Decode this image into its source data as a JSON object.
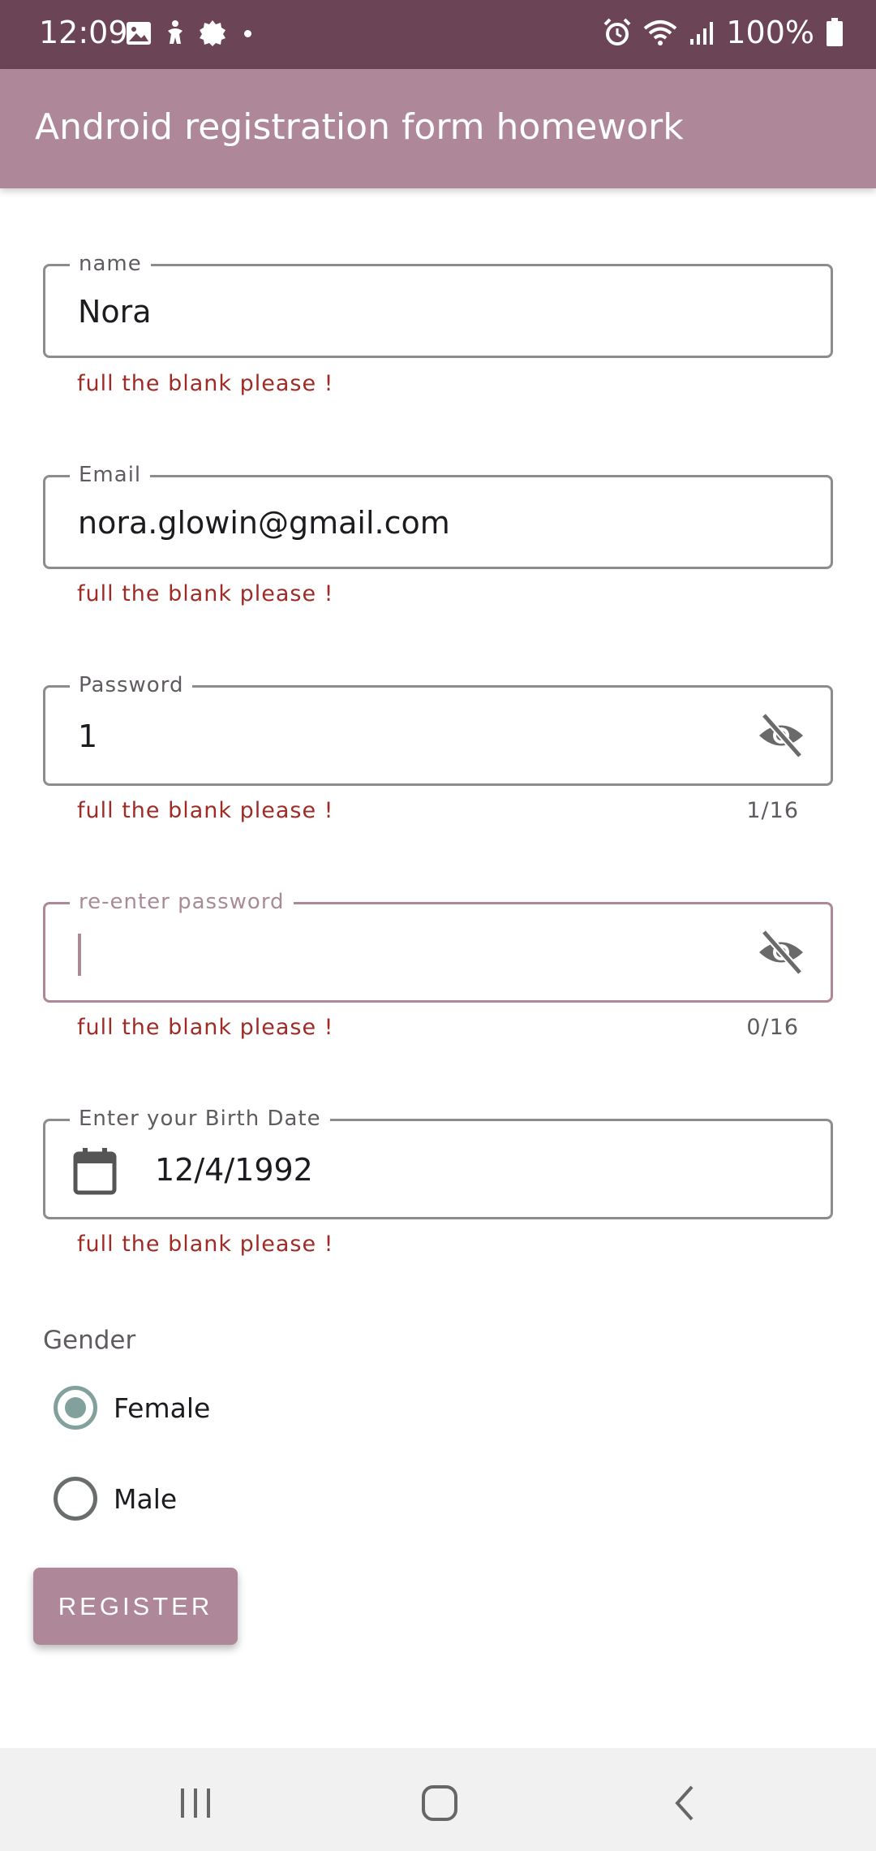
{
  "status_bar": {
    "time": "12:09",
    "battery": "100%",
    "icons": [
      "gallery-icon",
      "accessibility-icon",
      "settings-gear-icon",
      "notification-dot",
      "alarm-icon",
      "wifi-icon",
      "signal-icon",
      "battery-icon"
    ],
    "bg_color": "#6b4555"
  },
  "app_bar": {
    "title": "Android registration form homework",
    "bg_color": "#ae8899"
  },
  "form": {
    "name": {
      "label": "name",
      "value": "Nora",
      "error": "full the blank please !"
    },
    "email": {
      "label": "Email",
      "value": "nora.glowin@gmail.com",
      "error": "full the blank please !"
    },
    "password": {
      "label": "Password",
      "value": "1",
      "error": "full the blank please !",
      "counter": "1/16",
      "icon": "visibility-off-icon"
    },
    "reenter_password": {
      "label": "re-enter password",
      "value": "",
      "error": "full the blank please !",
      "counter": "0/16",
      "icon": "visibility-off-icon",
      "focused": true
    },
    "birth_date": {
      "label": "Enter your Birth Date",
      "value": "12/4/1992",
      "error": "full the blank please !",
      "icon": "calendar-icon"
    },
    "gender": {
      "label": "Gender",
      "options": [
        {
          "label": "Female",
          "selected": true
        },
        {
          "label": "Male",
          "selected": false
        }
      ]
    },
    "register_label": "REGISTER"
  },
  "nav_bar": {
    "buttons": [
      "recents-icon",
      "home-icon",
      "back-icon"
    ]
  },
  "colors": {
    "accent": "#ae8899",
    "error": "#9e2b25",
    "radio_checked": "#83a19c"
  }
}
